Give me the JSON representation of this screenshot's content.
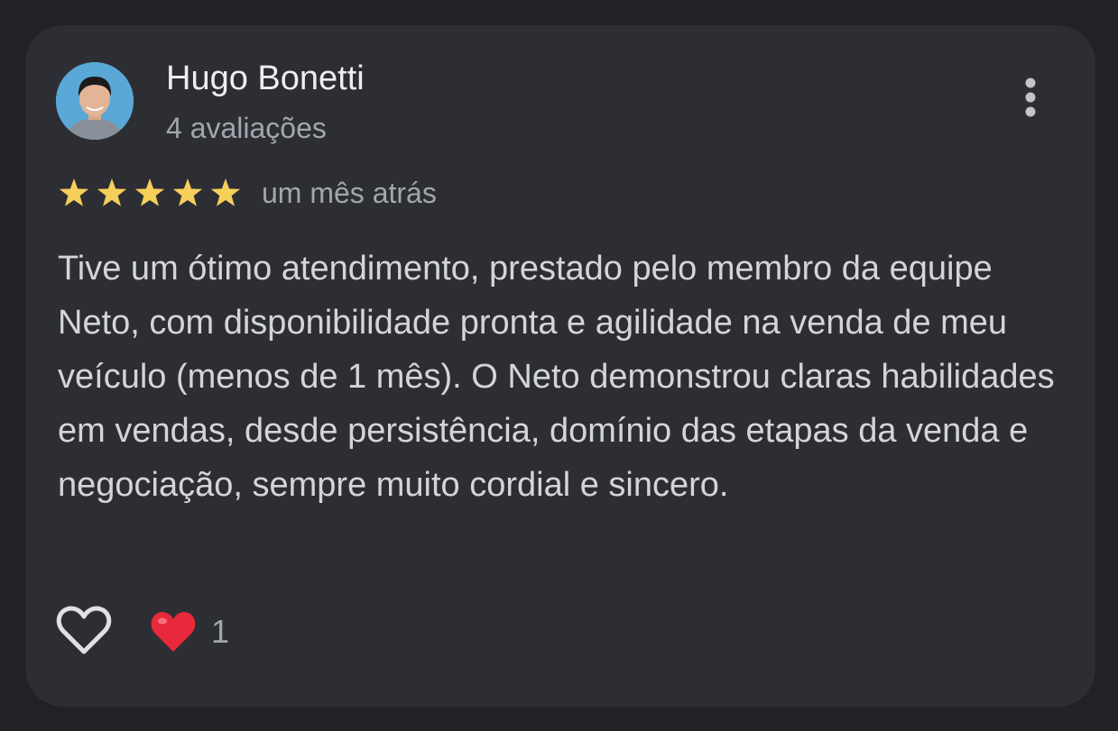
{
  "review": {
    "author_name": "Hugo Bonetti",
    "author_reviews": "4 avaliações",
    "rating": 5,
    "rating_max": 5,
    "date": "um mês atrás",
    "text": "Tive um ótimo atendimento, prestado pelo membro da equipe Neto, com disponibilidade pronta e agilidade na venda de meu veículo (menos de 1 mês). O Neto demonstrou claras habilidades em vendas, desde persistência, domínio das etapas da venda e negociação, sempre muito cordial e sincero."
  },
  "actions": {
    "like_icon": "heart-outline-icon",
    "more_icon": "more-vertical-icon"
  },
  "reactions": {
    "icon": "red-heart-icon",
    "count": "1"
  },
  "colors": {
    "background": "#212226",
    "card": "#2d2e33",
    "star": "#f6cf5b",
    "heart": "#e8283b"
  }
}
